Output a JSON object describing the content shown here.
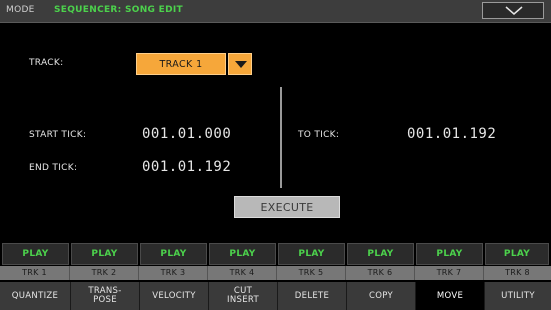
{
  "header": {
    "mode_label": "MODE",
    "section_title": "SEQUENCER: SONG EDIT",
    "menu_icon": "chevron-down-icon"
  },
  "track": {
    "label": "TRACK:",
    "selected": "TRACK 1"
  },
  "ticks": {
    "start_label": "START TICK:",
    "start_value": "001.01.000",
    "end_label": "END TICK:",
    "end_value": "001.01.192",
    "to_label": "TO TICK:",
    "to_value": "001.01.192"
  },
  "execute_label": "EXECUTE",
  "tracks": [
    {
      "play": "PLAY",
      "name": "TRK 1"
    },
    {
      "play": "PLAY",
      "name": "TRK 2"
    },
    {
      "play": "PLAY",
      "name": "TRK 3"
    },
    {
      "play": "PLAY",
      "name": "TRK 4"
    },
    {
      "play": "PLAY",
      "name": "TRK 5"
    },
    {
      "play": "PLAY",
      "name": "TRK 6"
    },
    {
      "play": "PLAY",
      "name": "TRK 7"
    },
    {
      "play": "PLAY",
      "name": "TRK 8"
    }
  ],
  "tabs": [
    {
      "label": "QUANTIZE"
    },
    {
      "label": "TRANS-\nPOSE"
    },
    {
      "label": "VELOCITY"
    },
    {
      "label": "CUT\nINSERT"
    },
    {
      "label": "DELETE"
    },
    {
      "label": "COPY"
    },
    {
      "label": "MOVE",
      "active": true
    },
    {
      "label": "UTILITY"
    }
  ],
  "colors": {
    "accent_green": "#4cd24c",
    "selector_orange": "#f6a73a"
  }
}
